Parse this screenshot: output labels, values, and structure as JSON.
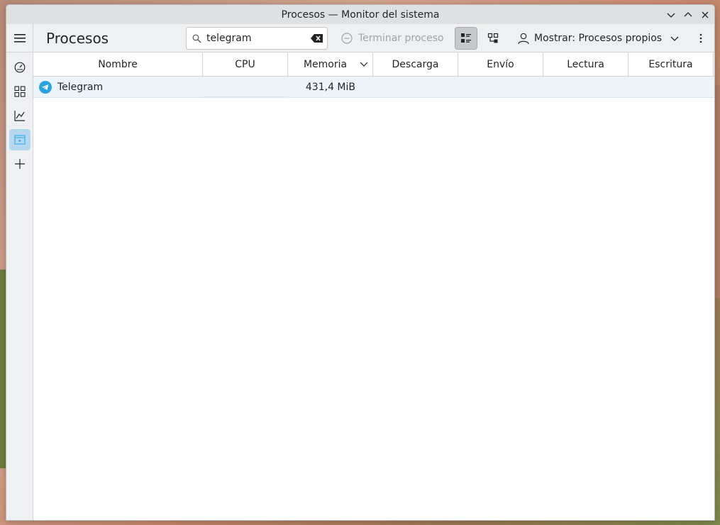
{
  "window": {
    "title": "Procesos — Monitor del sistema"
  },
  "toolbar": {
    "page_title": "Procesos",
    "search_value": "telegram",
    "kill_label": "Terminar proceso",
    "show_label": "Mostrar: Procesos propios"
  },
  "table": {
    "columns": [
      "Nombre",
      "CPU",
      "Memoria",
      "Descarga",
      "Envío",
      "Lectura",
      "Escritura"
    ],
    "sort_column": "Memoria",
    "rows": [
      {
        "name": "Telegram",
        "cpu": "",
        "memory": "431,4 MiB",
        "download": "",
        "upload": "",
        "read": "",
        "write": ""
      }
    ]
  },
  "colors": {
    "accent": "#3daee9",
    "row_highlight": "#edf5fb",
    "telegram": "#2aa3e0"
  },
  "icons": {
    "sidebar": [
      "speedometer-icon",
      "apps-grid-icon",
      "chart-icon",
      "window-play-icon",
      "plus-icon"
    ]
  }
}
